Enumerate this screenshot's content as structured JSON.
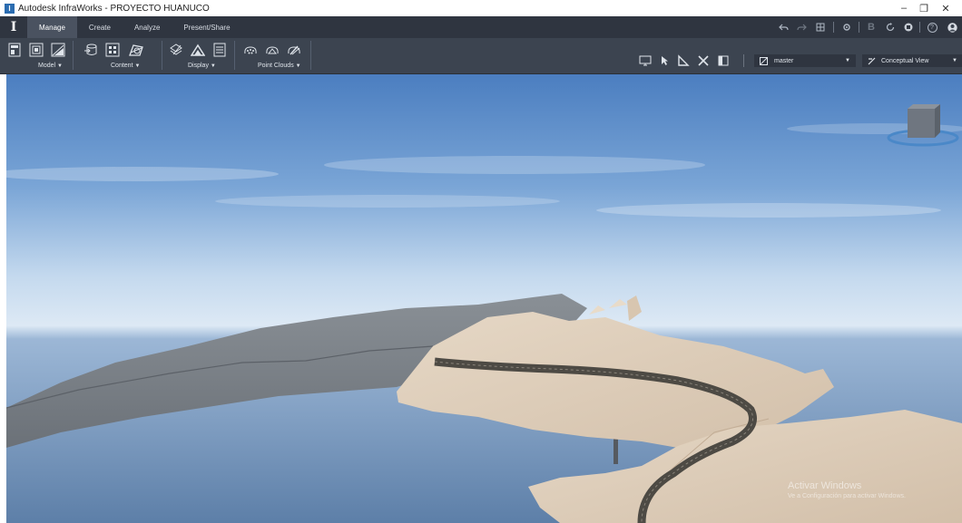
{
  "window": {
    "title": "Autodesk InfraWorks - PROYECTO HUANUCO",
    "app_icon_letter": "I",
    "controls": {
      "minimize": "–",
      "restore": "❐",
      "close": "✕"
    }
  },
  "ribbon": {
    "logo": "I",
    "tabs": [
      "Manage",
      "Create",
      "Analyze",
      "Present/Share"
    ],
    "active_tab": "Manage",
    "groups": {
      "model": "Model",
      "content": "Content",
      "display": "Display",
      "point_clouds": "Point Clouds"
    },
    "dropdown_arrow": "▼"
  },
  "quick_access": {
    "icons": [
      "undo-icon",
      "redo-icon",
      "grid-icon",
      "settings-icon",
      "bim360-icon",
      "sync-icon",
      "user-icon",
      "help-icon",
      "account-icon"
    ],
    "bim_letter": "B",
    "help_glyph": "?"
  },
  "view_toolbar": {
    "proposal": "master",
    "visual_style": "Conceptual View"
  },
  "watermark": {
    "title": "Activar Windows",
    "subtitle": "Ve a Configuración para activar Windows."
  },
  "colors": {
    "ribbon_dark": "#2f3540",
    "ribbon_panel": "#3c4450",
    "sky_top": "#4d7fc0",
    "terrain_light": "#d9c9b6",
    "terrain_grey": "#7c828a",
    "road": "#5f5a50"
  }
}
